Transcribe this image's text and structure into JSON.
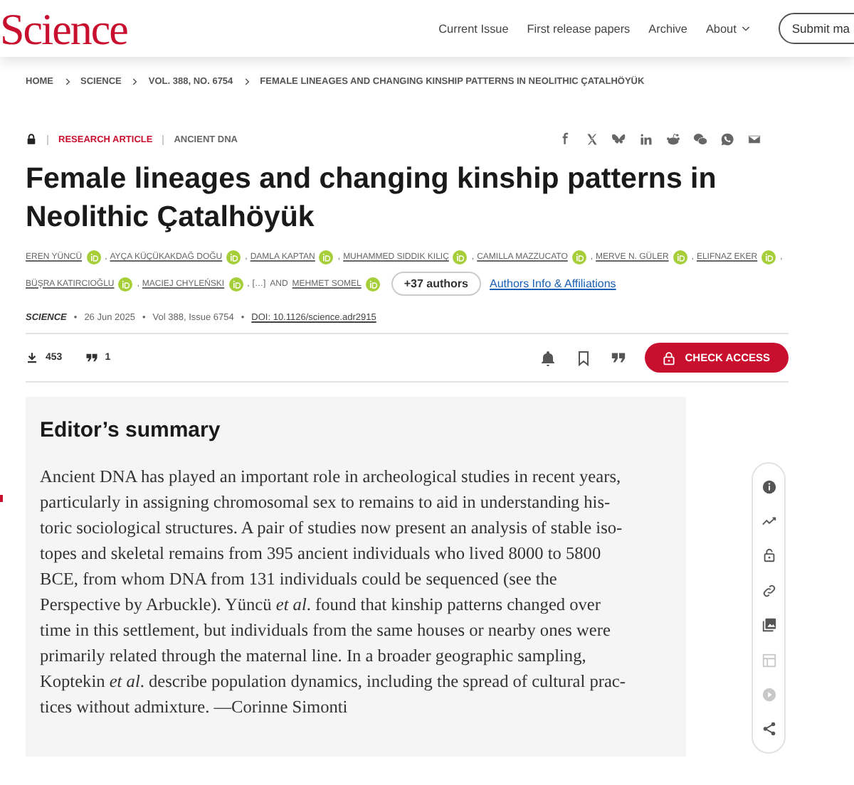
{
  "header": {
    "logo": "Science",
    "nav": [
      {
        "label": "Current Issue",
        "kind": "link"
      },
      {
        "label": "First release papers",
        "kind": "link"
      },
      {
        "label": "Archive",
        "kind": "link"
      },
      {
        "label": "About",
        "kind": "menu"
      }
    ],
    "submit_button": "Submit ma"
  },
  "breadcrumbs": [
    "HOME",
    "SCIENCE",
    "VOL. 388, NO. 6754",
    "FEMALE LINEAGES AND CHANGING KINSHIP PATTERNS IN NEOLITHIC ÇATALHÖYÜK"
  ],
  "article": {
    "locked": true,
    "type": "RESEARCH ARTICLE",
    "topic": "ANCIENT DNA",
    "share": [
      {
        "kind": "facebook"
      },
      {
        "kind": "x"
      },
      {
        "kind": "bluesky"
      },
      {
        "kind": "linkedin"
      },
      {
        "kind": "reddit"
      },
      {
        "kind": "wechat"
      },
      {
        "kind": "whatsapp"
      },
      {
        "kind": "email"
      }
    ],
    "title": "Female lineages and changing kinship patterns in Neolithic Çatalhöyük",
    "authors": [
      {
        "name": "EREN YÜNCÜ",
        "orcid": true
      },
      {
        "name": "AYÇA KÜÇÜKAKDAĞ DOĞU",
        "orcid": true
      },
      {
        "name": "DAMLA KAPTAN",
        "orcid": true
      },
      {
        "name": "MUHAMMED SIDDIK KILIÇ",
        "orcid": true
      },
      {
        "name": "CAMILLA MAZZUCATO",
        "orcid": true
      },
      {
        "name": "MERVE N. GÜLER",
        "orcid": true
      },
      {
        "name": "ELIFNAZ EKER",
        "orcid": true
      },
      {
        "name": "BÜŞRA KATIRCIOĞLU",
        "orcid": true
      },
      {
        "name": "MACIEJ CHYLEŃSKI",
        "orcid": true
      }
    ],
    "author_separator": ",",
    "omitted": "[…]",
    "conjunction": "AND",
    "last_author": {
      "name": "MEHMET SOMEL",
      "orcid": true
    },
    "more_authors": "+37 authors",
    "affiliations_link": "Authors Info & Affiliations",
    "meta": {
      "journal": "SCIENCE",
      "separator": "•",
      "date": "26 Jun 2025",
      "volume": "Vol 388, Issue 6754",
      "doi": "DOI: 10.1126/science.adr2915"
    },
    "downloads": "453",
    "citations": "1",
    "check_access": "CHECK ACCESS"
  },
  "summary": {
    "heading": "Editor’s summary",
    "lines": [
      "Ancient DNA has played an important role in archeological studies in recent years,",
      "particularly in assigning chromosomal sex to remains to aid in understanding his-",
      "toric sociological structures. A pair of studies now present an analysis of stable iso-",
      "topes and skeletal remains from 395 ancient individuals who lived 8000 to 5800",
      "BCE, from whom DNA from 131 individuals could be sequenced (see the",
      "Perspective by Arbuckle). Yüncü *et al*. found that kinship patterns changed over",
      "time in this settlement, but individuals from the same houses or nearby ones were",
      "primarily related through the maternal line. In a broader geographic sampling,",
      "Koptekin *et al*. describe population dynamics, including the spread of cultural prac-",
      "tices without admixture. —Corinne Simonti"
    ]
  },
  "side_rail": [
    {
      "kind": "info",
      "disabled": false
    },
    {
      "kind": "metrics",
      "disabled": false
    },
    {
      "kind": "access",
      "disabled": false
    },
    {
      "kind": "link",
      "disabled": false
    },
    {
      "kind": "figures",
      "disabled": false
    },
    {
      "kind": "tables",
      "disabled": true
    },
    {
      "kind": "media",
      "disabled": true
    },
    {
      "kind": "share",
      "disabled": false
    }
  ]
}
